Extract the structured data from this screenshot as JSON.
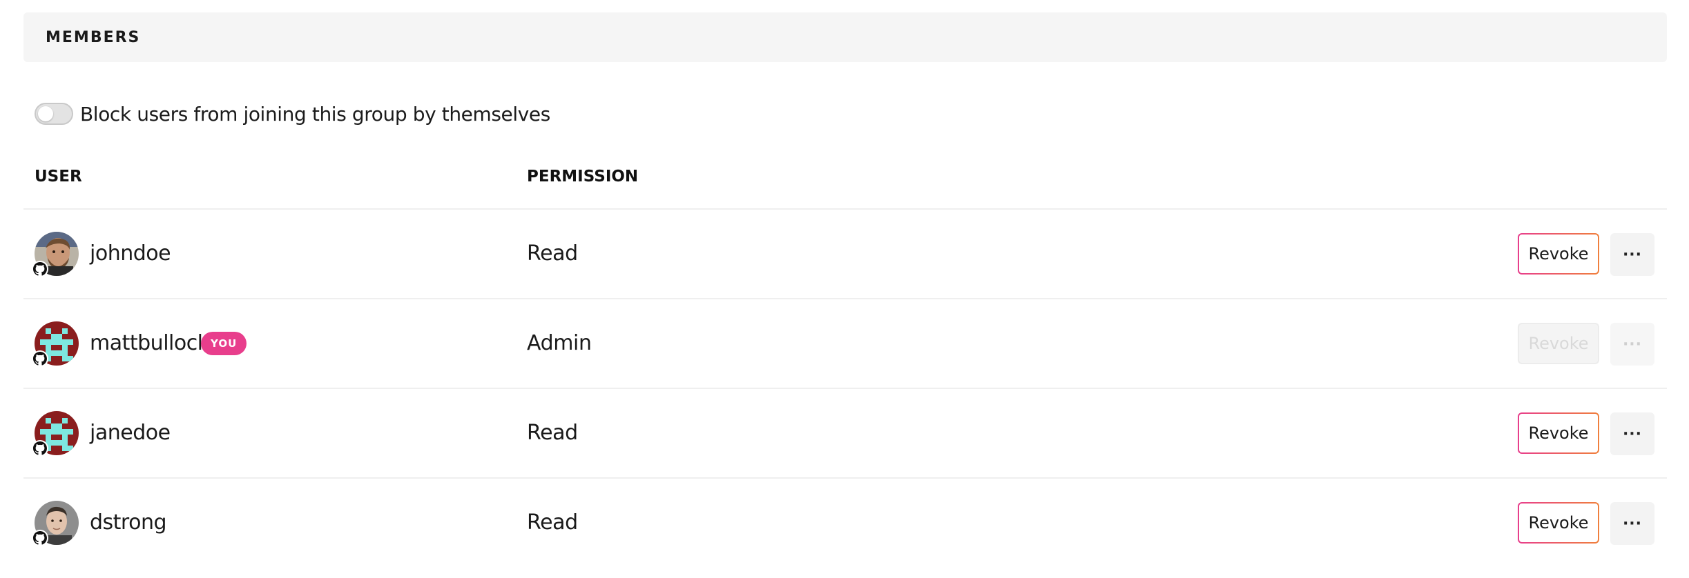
{
  "section": {
    "title": "MEMBERS"
  },
  "settings": {
    "block_self_join_label": "Block users from joining this group by themselves",
    "block_self_join_enabled": false
  },
  "table": {
    "columns": {
      "user": "USER",
      "permission": "PERMISSION"
    },
    "rows": [
      {
        "username": "johndoe",
        "you_badge": "",
        "permission": "Read",
        "revoke_label": "Revoke",
        "more_label": "···",
        "actions_enabled": true,
        "avatar": "photo-bearded-man"
      },
      {
        "username": "mattbullock",
        "you_badge": "YOU",
        "permission": "Admin",
        "revoke_label": "Revoke",
        "more_label": "···",
        "actions_enabled": false,
        "avatar": "identicon-cyan-on-red"
      },
      {
        "username": "janedoe",
        "you_badge": "",
        "permission": "Read",
        "revoke_label": "Revoke",
        "more_label": "···",
        "actions_enabled": true,
        "avatar": "identicon-cyan-on-red"
      },
      {
        "username": "dstrong",
        "you_badge": "",
        "permission": "Read",
        "revoke_label": "Revoke",
        "more_label": "···",
        "actions_enabled": true,
        "avatar": "photo-man-grey"
      }
    ]
  },
  "colors": {
    "you_badge": "#e83e8c",
    "revoke_gradient_start": "#e83e8c",
    "revoke_gradient_end": "#f0803c",
    "identicon_bg": "#8a1e1e",
    "identicon_fg": "#7ee8e0"
  },
  "icons": {
    "provider_badge": "github-icon"
  }
}
